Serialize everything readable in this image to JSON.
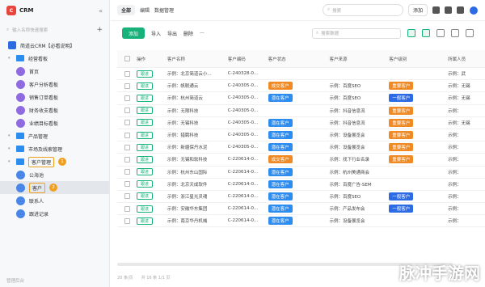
{
  "app": {
    "title": "CRM"
  },
  "sidebar": {
    "search_placeholder": "输入名称快速搜索",
    "tree": [
      {
        "label": "简道云CRM【必看说明】",
        "level": 0,
        "type": "book"
      },
      {
        "label": "经营看板",
        "level": 0,
        "type": "folder"
      },
      {
        "label": "首页",
        "level": 1,
        "type": "page"
      },
      {
        "label": "客户分析看板",
        "level": 1,
        "type": "page"
      },
      {
        "label": "销售订单看板",
        "level": 1,
        "type": "page"
      },
      {
        "label": "财务收支看板",
        "level": 1,
        "type": "page"
      },
      {
        "label": "业绩目标看板",
        "level": 1,
        "type": "page"
      },
      {
        "label": "产品管理",
        "level": 0,
        "type": "folder"
      },
      {
        "label": "市场及线索管理",
        "level": 0,
        "type": "folder"
      },
      {
        "label": "客户管理",
        "level": 0,
        "type": "folder",
        "badge": "1"
      },
      {
        "label": "公海池",
        "level": 1,
        "type": "form"
      },
      {
        "label": "客户",
        "level": 1,
        "type": "form",
        "badge": "2",
        "active": true
      },
      {
        "label": "联系人",
        "level": 1,
        "type": "form"
      },
      {
        "label": "跟进记录",
        "level": 1,
        "type": "form"
      }
    ],
    "footer": "管理后台"
  },
  "topbar": {
    "view": "全部",
    "edit": "编辑",
    "manage": "数据管理",
    "search": "搜索",
    "add": "添加"
  },
  "toolbar": {
    "new": "添加",
    "import": "导入",
    "export": "导出",
    "delete": "删除",
    "more": "···",
    "search_placeholder": "搜索数据"
  },
  "table": {
    "headers": [
      "操作",
      "客户名称",
      "客户编码",
      "客户状态",
      "客户来源",
      "客户级别",
      "所属人员"
    ],
    "rows": [
      {
        "name": "示例：北京简道云小...",
        "code": "C-240328-0...",
        "status": "",
        "status_color": "",
        "source": "",
        "level": "",
        "level_color": "",
        "owner": "示例：武"
      },
      {
        "name": "示例：帆联通云",
        "code": "C-240305-0...",
        "status": "成交客户",
        "status_color": "orange",
        "source": "示例：百度SEO",
        "level": "重要客户",
        "level_color": "orange",
        "owner": "示例：无锡"
      },
      {
        "name": "示例：杭州简道云",
        "code": "C-240305-0...",
        "status": "潜在客户",
        "status_color": "blue",
        "source": "示例：百度SEO",
        "level": "一般客户",
        "level_color": "deep",
        "owner": "示例：无锡"
      },
      {
        "name": "示例：无限科技",
        "code": "C-240305-0...",
        "status": "",
        "status_color": "",
        "source": "示例：抖音信息流",
        "level": "重要客户",
        "level_color": "orange",
        "owner": "示例："
      },
      {
        "name": "示例：无锡科技",
        "code": "C-240305-0...",
        "status": "潜在客户",
        "status_color": "blue",
        "source": "示例：抖音信息流",
        "level": "重要客户",
        "level_color": "orange",
        "owner": "示例：无锡"
      },
      {
        "name": "示例：猎聘科技",
        "code": "C-240305-0...",
        "status": "潜在客户",
        "status_color": "blue",
        "source": "示例：设备展览会",
        "level": "重要客户",
        "level_color": "orange",
        "owner": "示例："
      },
      {
        "name": "示例：新疆保丹水泥",
        "code": "C-240305-0...",
        "status": "潜在客户",
        "status_color": "blue",
        "source": "示例：设备展览会",
        "level": "重要客户",
        "level_color": "orange",
        "owner": "示例："
      },
      {
        "name": "示例：无锡和软科技",
        "code": "C-220614-0...",
        "status": "成交客户",
        "status_color": "orange",
        "source": "示例：找下行业名录",
        "level": "重要客户",
        "level_color": "orange",
        "owner": "示例："
      },
      {
        "name": "示例：杭州东山国际",
        "code": "C-220614-0...",
        "status": "潜在客户",
        "status_color": "blue",
        "source": "示例：杭州美通商会",
        "level": "",
        "level_color": "",
        "owner": "示例："
      },
      {
        "name": "示例：北京天成软件",
        "code": "C-220614-0...",
        "status": "潜在客户",
        "status_color": "blue",
        "source": "示例：百度广告-SEM",
        "level": "",
        "level_color": "",
        "owner": "示例："
      },
      {
        "name": "示例：浙江星光灵魂",
        "code": "C-220614-0...",
        "status": "潜在客户",
        "status_color": "blue",
        "source": "示例：百度SEO",
        "level": "一般客户",
        "level_color": "deep",
        "owner": "示例："
      },
      {
        "name": "示例：安徽华东集团",
        "code": "C-220614-0...",
        "status": "潜在客户",
        "status_color": "blue",
        "source": "示例：产品发布会",
        "level": "一般客户",
        "level_color": "deep",
        "owner": "示例："
      },
      {
        "name": "示例：南京华丹机械",
        "code": "C-220614-0...",
        "status": "潜在客户",
        "status_color": "blue",
        "source": "示例：设备展览会",
        "level": "",
        "level_color": "",
        "owner": "示例："
      }
    ],
    "follow_label": "跟进"
  },
  "footer": {
    "page_size": "20 条/页",
    "pages": "共 16 条 1/1 页"
  },
  "watermark": "脉冲手游网"
}
